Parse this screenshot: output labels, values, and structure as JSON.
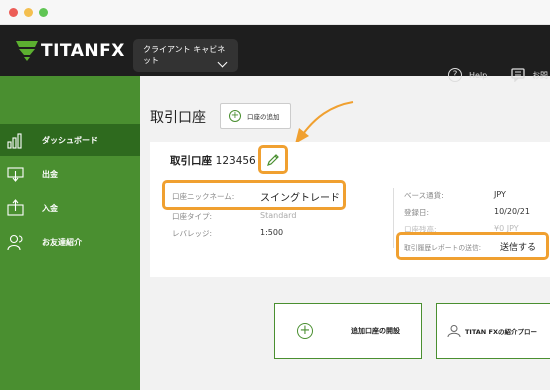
{
  "header": {
    "logo_main": "TITAN",
    "logo_fx": "FX",
    "cabinet_label": "クライアント キャビネット",
    "help_label": "Help",
    "contact_label": "お問"
  },
  "sidebar": {
    "items": [
      {
        "label": "ダッシュボード",
        "icon": "bar-chart-icon",
        "active": true
      },
      {
        "label": "出金",
        "icon": "withdraw-icon",
        "active": false
      },
      {
        "label": "入金",
        "icon": "deposit-icon",
        "active": false
      },
      {
        "label": "お友達紹介",
        "icon": "referral-icon",
        "active": false
      }
    ]
  },
  "main": {
    "title": "取引口座",
    "add_account_label": "口座の追加",
    "account_title": "取引口座",
    "account_number": "123456",
    "left_fields": [
      {
        "label": "口座ニックネーム:",
        "value": "スイングトレード"
      },
      {
        "label": "口座タイプ:",
        "value": "Standard"
      },
      {
        "label": "レバレッジ:",
        "value": "1:500"
      }
    ],
    "right_fields": [
      {
        "label": "ベース通貨:",
        "value": "JPY"
      },
      {
        "label": "登録日:",
        "value": "10/20/21"
      },
      {
        "label": "口座残高:",
        "value": "¥0 JPY"
      },
      {
        "label": "取引履歴レポートの送信:",
        "value": "送信する"
      }
    ]
  },
  "bottom": {
    "open_account_label": "追加口座の開設",
    "referral_label": "TITAN FXの紹介プロー"
  },
  "colors": {
    "green": "#4a8f30",
    "dark_green": "#2e6a1e",
    "accent_orange": "#f0a030",
    "topbar": "#1e1e1e"
  }
}
